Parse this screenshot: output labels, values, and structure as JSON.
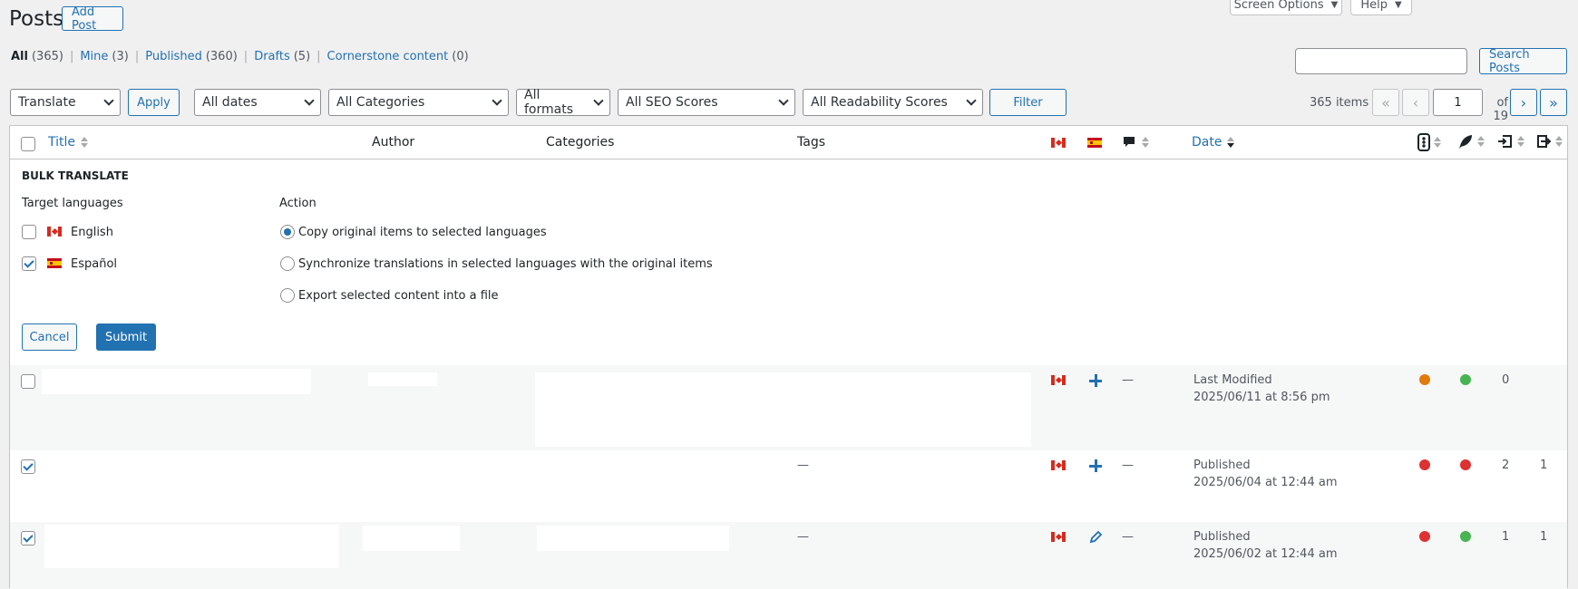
{
  "header": {
    "title": "Posts",
    "add_new": "Add Post",
    "screen_options": "Screen Options",
    "help": "Help"
  },
  "views": [
    {
      "label": "All",
      "count": "(365)"
    },
    {
      "label": "Mine",
      "count": "(3)"
    },
    {
      "label": "Published",
      "count": "(360)"
    },
    {
      "label": "Drafts",
      "count": "(5)"
    },
    {
      "label": "Cornerstone content",
      "count": "(0)"
    }
  ],
  "search": {
    "value": "",
    "button": "Search Posts"
  },
  "filters": {
    "bulk_action": "Translate",
    "apply": "Apply",
    "dates": "All dates",
    "categories": "All Categories",
    "formats": "All formats",
    "seo": "All SEO Scores",
    "readability": "All Readability Scores",
    "filter": "Filter"
  },
  "pagination": {
    "items": "365 items",
    "current_page": "1",
    "of_total": "of 19",
    "first": "«",
    "prev": "‹",
    "next": "›",
    "last": "»"
  },
  "columns": {
    "title": "Title",
    "author": "Author",
    "categories": "Categories",
    "tags": "Tags",
    "date": "Date"
  },
  "bulk_translate": {
    "heading": "BULK TRANSLATE",
    "target_languages_label": "Target languages",
    "action_label": "Action",
    "languages": [
      {
        "name": "English",
        "checked": false
      },
      {
        "name": "Español",
        "checked": true
      }
    ],
    "actions": [
      {
        "label": "Copy original items to selected languages",
        "checked": true
      },
      {
        "label": "Synchronize translations in selected languages with the original items",
        "checked": false
      },
      {
        "label": "Export selected content into a file",
        "checked": false
      }
    ],
    "cancel": "Cancel",
    "submit": "Submit"
  },
  "rows": [
    {
      "checked": false,
      "tags": "",
      "comments": "—",
      "status": "Last Modified",
      "date": "2025/06/11 at 8:56 pm",
      "seo_color": "#e07b0c",
      "read_color": "#46b450",
      "links_in": "0",
      "links_out": "",
      "es_icon": "plus-icon"
    },
    {
      "checked": true,
      "tags": "—",
      "comments": "—",
      "status": "Published",
      "date": "2025/06/04 at 12:44 am",
      "seo_color": "#dc3232",
      "read_color": "#dc3232",
      "links_in": "2",
      "links_out": "1",
      "es_icon": "plus-icon"
    },
    {
      "checked": true,
      "tags": "—",
      "comments": "—",
      "status": "Published",
      "date": "2025/06/02 at 12:44 am",
      "seo_color": "#dc3232",
      "read_color": "#46b450",
      "links_in": "1",
      "links_out": "1",
      "es_icon": "pencil-icon"
    }
  ]
}
